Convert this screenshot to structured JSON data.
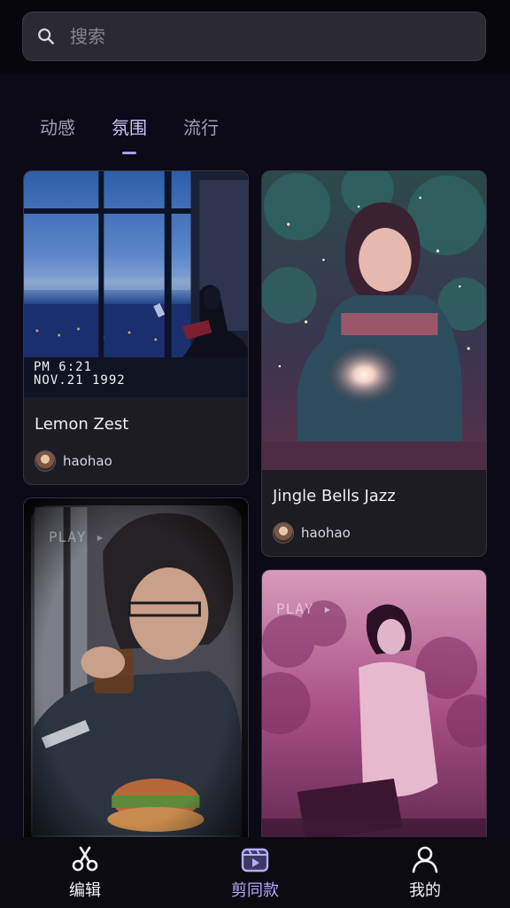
{
  "search": {
    "placeholder": "搜索"
  },
  "tabs": [
    {
      "label": "动感"
    },
    {
      "label": "氛围"
    },
    {
      "label": "流行"
    }
  ],
  "cards": [
    {
      "title": "Lemon Zest",
      "author": "haohao",
      "overlay_time": "PM  6:21",
      "overlay_date": "NOV.21 1992"
    },
    {
      "title": "Jingle Bells Jazz",
      "author": "haohao"
    },
    {
      "overlay_text": "PLAY ▸"
    },
    {
      "overlay_text": "PLAY ▸"
    }
  ],
  "bottom_nav": [
    {
      "label": "编辑",
      "icon": "scissors-icon"
    },
    {
      "label": "剪同款",
      "icon": "template-video-icon"
    },
    {
      "label": "我的",
      "icon": "profile-icon"
    }
  ],
  "colors": {
    "accent": "#b6acff",
    "background": "#0b0a16"
  }
}
